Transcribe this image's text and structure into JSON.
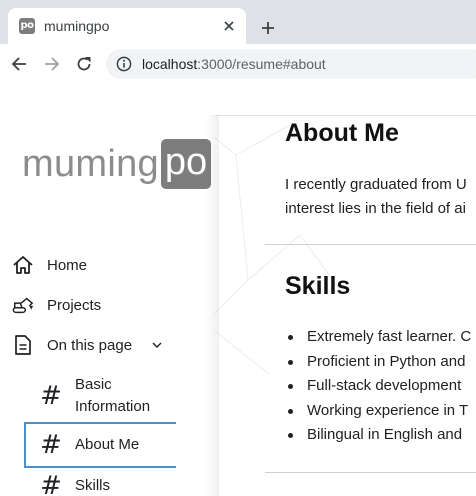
{
  "browser": {
    "tab": {
      "favicon_text": "po",
      "title": "mumingpo"
    },
    "address": {
      "host": "localhost",
      "rest": ":3000/resume#about"
    },
    "icons": {
      "close": "close-icon",
      "new_tab": "plus-icon",
      "back": "arrow-left-icon",
      "forward": "arrow-right-icon",
      "reload": "reload-icon",
      "site_info": "info-icon"
    }
  },
  "sidebar": {
    "logo": {
      "text": "muming",
      "box": "po"
    },
    "nav": [
      {
        "label": "Home",
        "icon": "home-icon"
      },
      {
        "label": "Projects",
        "icon": "excavator-icon"
      },
      {
        "label": "On this page",
        "icon": "document-icon",
        "expanded": true
      }
    ],
    "toc": [
      {
        "label": "Basic\nInformation",
        "active": false
      },
      {
        "label": "About Me",
        "active": true
      },
      {
        "label": "Skills",
        "active": false
      }
    ],
    "toc_marker": "#"
  },
  "main": {
    "about": {
      "heading": "About Me",
      "line1": "I recently graduated from U",
      "line2": "interest lies in the field of ai"
    },
    "skills": {
      "heading": "Skills",
      "items": [
        "Extremely fast learner. C",
        "Proficient in Python and",
        "Full-stack development",
        "Working experience in T",
        "Bilingual in English and"
      ]
    }
  },
  "colors": {
    "accent": "#4a90c8",
    "logo_gray": "#8c8c8c",
    "logo_box": "#7d7d7d",
    "tabstrip": "#dee1e6"
  }
}
